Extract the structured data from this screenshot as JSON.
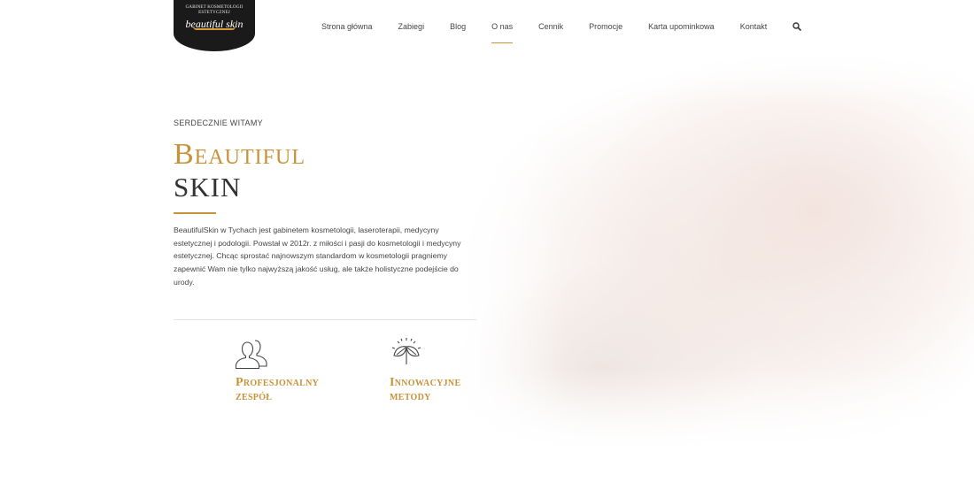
{
  "logo": {
    "tagline": "GABINET KOSMETOLOGII ESTETYCZNEJ",
    "brand": "beautiful skin"
  },
  "nav": {
    "items": [
      "Strona główna",
      "Zabiegi",
      "Blog",
      "O nas",
      "Cennik",
      "Promocje",
      "Karta upominkowa",
      "Kontakt"
    ],
    "active": "O nas",
    "search_icon": "search-icon"
  },
  "intro": {
    "eyebrow": "SERDECZNIE WITAMY",
    "title_line1": "Beautiful",
    "title_line2": "SKIN",
    "description": "BeautifulSkin w Tychach jest gabinetem kosmetologii, laseroterapii, medycyny estetycznej i podologii. Powstał w 2012r. z miłości i pasji do kosmetologii i medycyny estetycznej. Chcąc sprostać najnowszym standardom w kosmetologii pragniemy zapewnić Wam nie tylko najwyższą jakość usług, ale także holistyczne podejście do urody."
  },
  "features": [
    {
      "icon": "team-icon",
      "label_line1": "Profesjonalny",
      "label_line2": "zespół"
    },
    {
      "icon": "innovation-leaf-icon",
      "label_line1": "Innowacyjne",
      "label_line2": "metody"
    }
  ],
  "colors": {
    "accent": "#c8923a",
    "text": "#333333",
    "logo_bg": "#1a1a1a"
  }
}
